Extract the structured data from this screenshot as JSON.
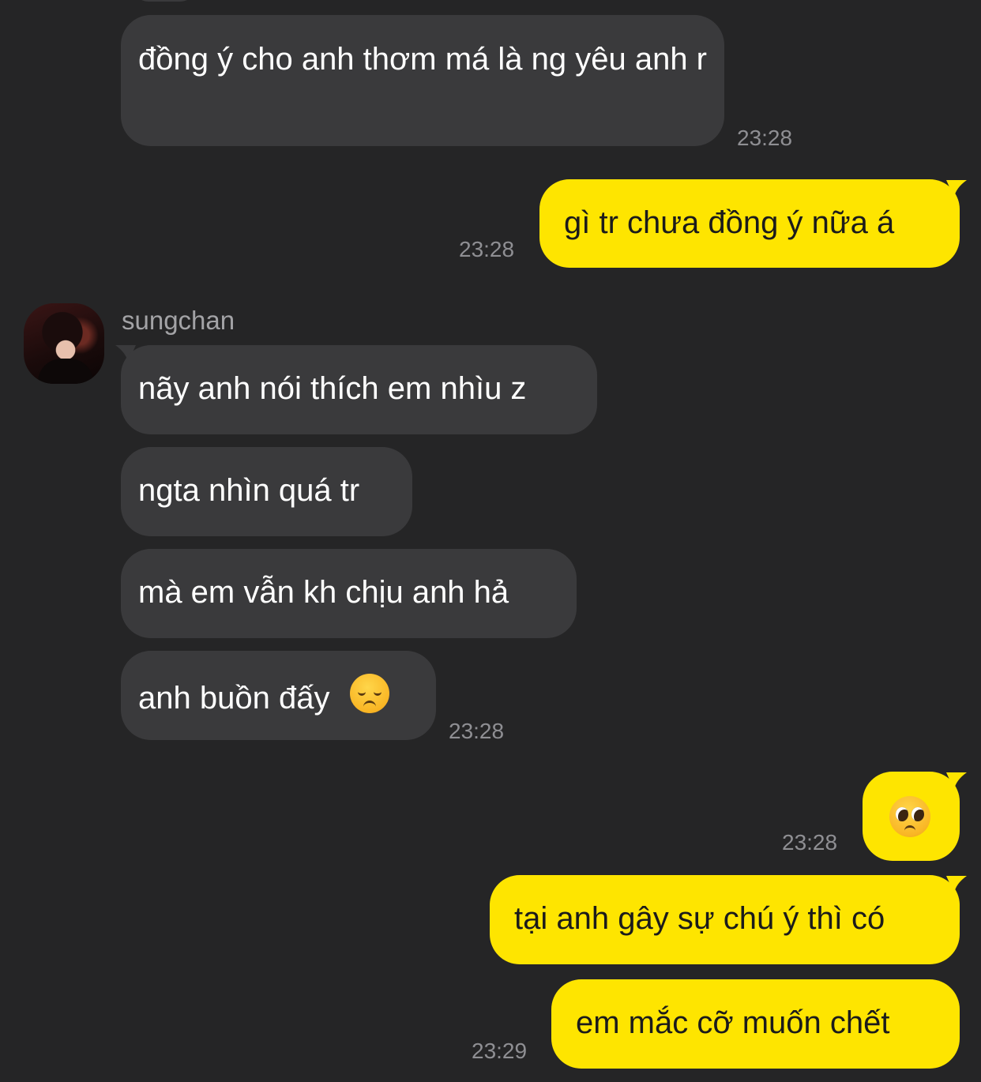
{
  "colors": {
    "background": "#252526",
    "incoming_bubble": "#3a3a3c",
    "outgoing_bubble": "#fee500",
    "timestamp": "#8f8f93"
  },
  "messages": {
    "m1": {
      "text": "đồng ý cho anh thơm má là ng yêu anh r",
      "time": "23:28"
    },
    "m2": {
      "text": "gì tr chưa đồng ý nữa á",
      "time": "23:28"
    },
    "sender": {
      "name": "sungchan"
    },
    "m3": {
      "text": "nãy anh nói thích em nhìu z"
    },
    "m4": {
      "text": "ngta nhìn quá tr"
    },
    "m5": {
      "text": "mà em vẫn kh chịu anh hả"
    },
    "m6": {
      "text": "anh buồn đấy",
      "emoji": "disappointed-face-icon",
      "time": "23:28"
    },
    "m7": {
      "emoji": "pleading-face-icon",
      "time": "23:28"
    },
    "m8": {
      "text": "tại anh gây sự chú ý thì có"
    },
    "m9": {
      "text": "em mắc cỡ muốn chết",
      "time": "23:29"
    }
  }
}
